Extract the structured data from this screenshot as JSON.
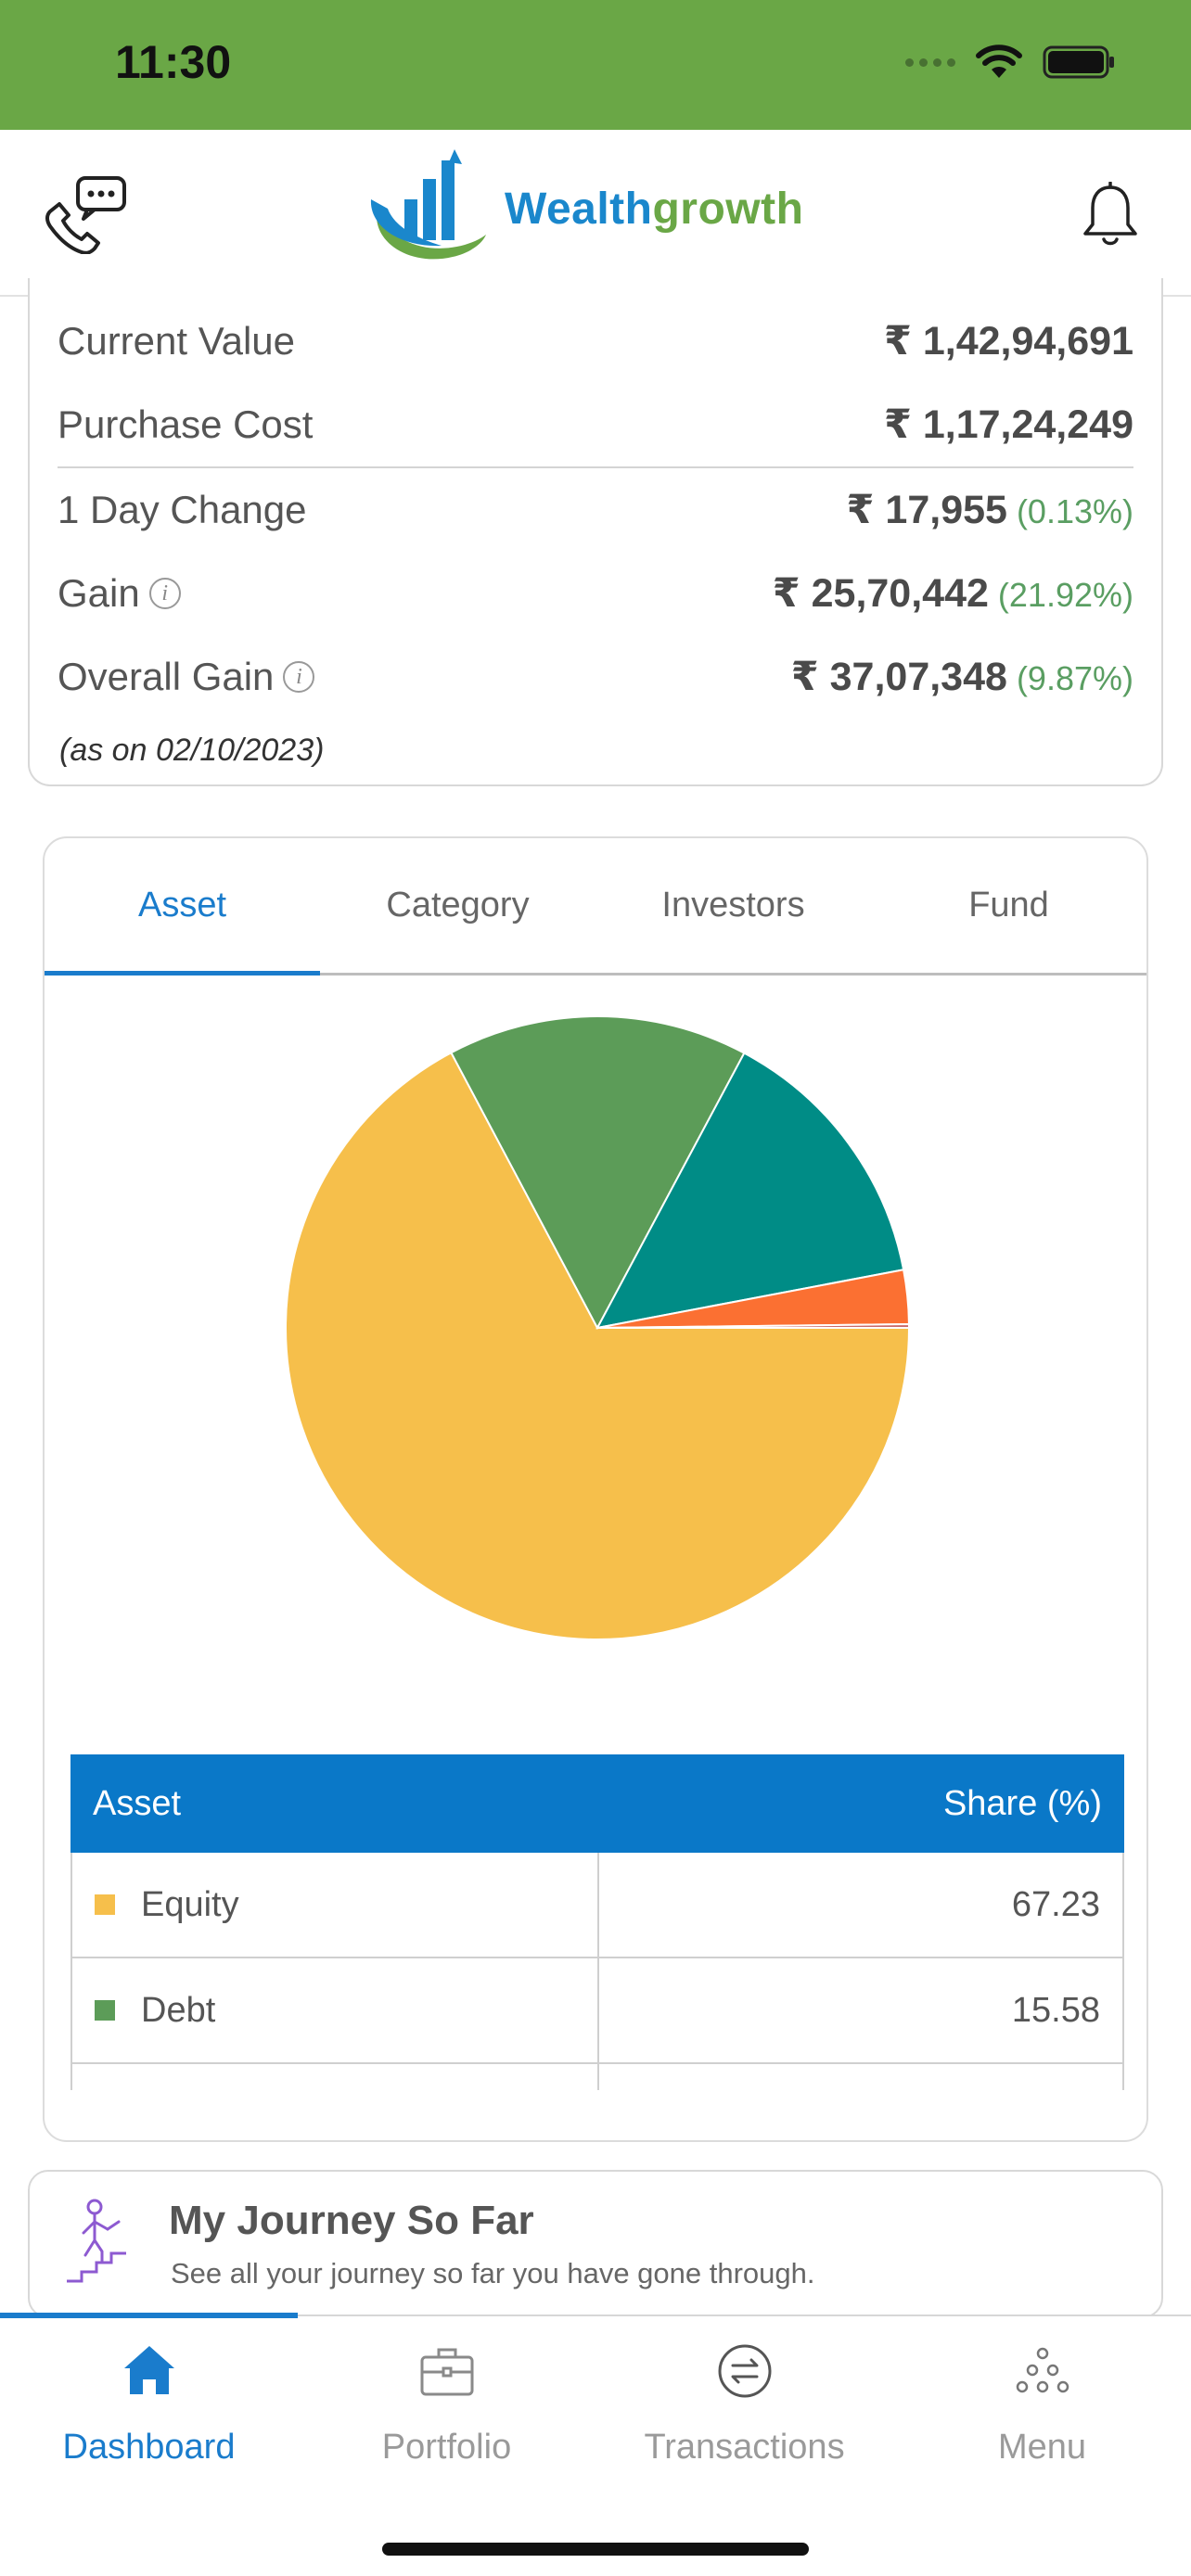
{
  "status_bar": {
    "time": "11:30"
  },
  "header": {
    "logo_part1": "Wealth",
    "logo_part2": "growth",
    "colors": {
      "blue": "#1a87cc",
      "green": "#6aa746"
    }
  },
  "summary": {
    "rows": [
      {
        "label": "Current Value",
        "value": "₹ 1,42,94,691",
        "pct": ""
      },
      {
        "label": "Purchase Cost",
        "value": "₹ 1,17,24,249",
        "pct": ""
      },
      {
        "label": "1 Day Change",
        "value": "₹ 17,955",
        "pct": "(0.13%)"
      },
      {
        "label": "Gain",
        "value": "₹ 25,70,442",
        "pct": "(21.92%)"
      },
      {
        "label": "Overall Gain",
        "value": "₹ 37,07,348",
        "pct": "(9.87%)"
      }
    ],
    "as_on": "(as on 02/10/2023)",
    "info_glyph": "i"
  },
  "tabs": [
    "Asset",
    "Category",
    "Investors",
    "Fund"
  ],
  "active_tab": "Asset",
  "chart_data": {
    "type": "pie",
    "slices": [
      {
        "label": "Equity",
        "value": 67.23,
        "color": "#f6bf4b"
      },
      {
        "label": "Debt",
        "value": 15.58,
        "color": "#5c9c58"
      },
      {
        "label": "",
        "value": 14.2,
        "color": "#008c86"
      },
      {
        "label": "",
        "value": 2.8,
        "color": "#fb7032"
      },
      {
        "label": "",
        "value": 0.19,
        "color": "#c96a6a"
      }
    ]
  },
  "table": {
    "header_asset": "Asset",
    "header_share": "Share (%)",
    "rows": [
      {
        "asset": "Equity",
        "share": "67.23",
        "color": "#f6bf4b"
      },
      {
        "asset": "Debt",
        "share": "15.58",
        "color": "#5c9c58"
      }
    ]
  },
  "journey": {
    "title": "My Journey So Far",
    "subtitle": "See all your journey so far you have gone through."
  },
  "nav": {
    "items": [
      "Dashboard",
      "Portfolio",
      "Transactions",
      "Menu"
    ],
    "active_color": "#1a7ccc"
  }
}
